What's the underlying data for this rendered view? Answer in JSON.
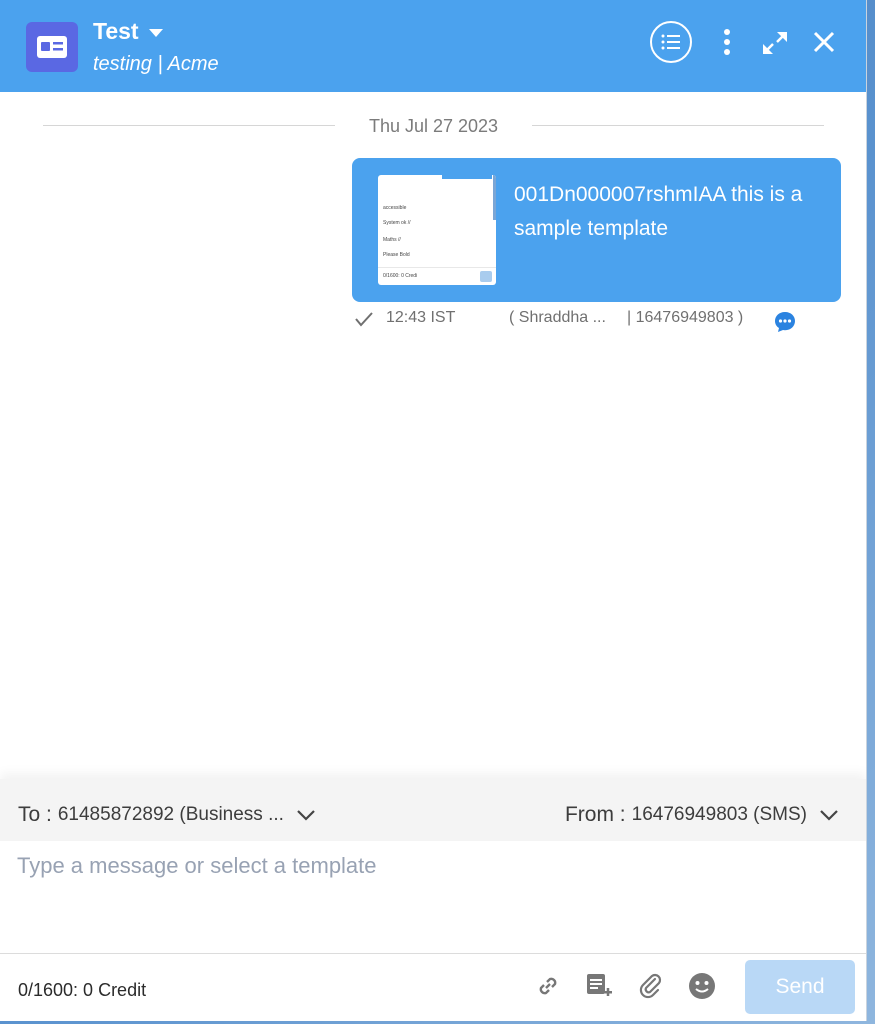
{
  "header": {
    "title": "Test",
    "subtitle": "testing | Acme",
    "accent_color": "#4ba2ee",
    "avatar_color": "#5a68e3"
  },
  "conversation": {
    "date_separator": "Thu Jul 27 2023",
    "messages": [
      {
        "text": "001Dn000007rshmIAA this is a sample template",
        "time": "12:43 IST",
        "sender": "( Shraddha ...",
        "sender_number": "| 16476949803 )",
        "status_icon": "check-icon",
        "channel_icon": "chat-bubble-icon",
        "thumbnail_lines": [
          "accessible",
          "System ok //",
          "Maths //",
          "Please Bold",
          "0/1600: 0 Credi"
        ]
      }
    ]
  },
  "composer": {
    "to_label": "To :",
    "to_value": "61485872892 (Business ...",
    "from_label": "From :",
    "from_value": "16476949803 (SMS)",
    "placeholder": "Type a message or select a template",
    "counter": "0/1600: 0 Credit",
    "send_label": "Send",
    "icons": [
      "link-icon",
      "template-add-icon",
      "attachment-icon",
      "emoji-icon"
    ]
  }
}
